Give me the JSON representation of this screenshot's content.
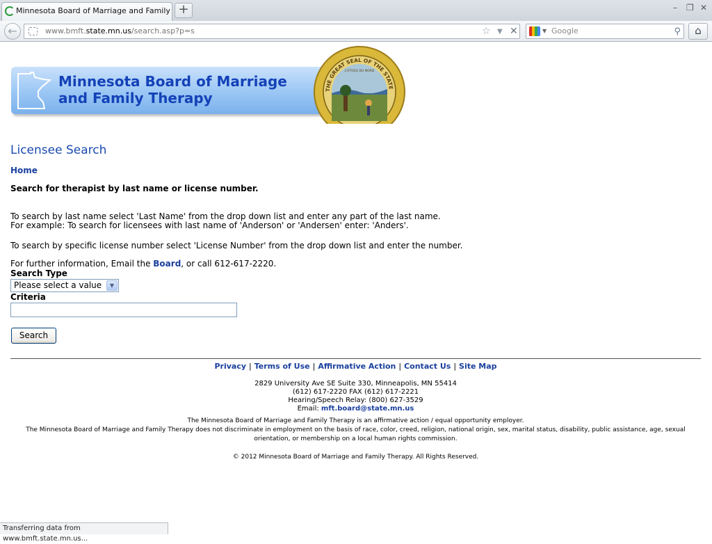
{
  "browser": {
    "tab_title": "Minnesota Board of Marriage and Family The...",
    "new_tab_label": "+",
    "url_prefix": "www.bmft.",
    "url_domain": "state.mn.us",
    "url_path": "/search.asp?p=s",
    "search_placeholder": "Google",
    "status_text": "Transferring data from www.bmft.state.mn.us..."
  },
  "banner": {
    "title_line1": "Minnesota Board of Marriage",
    "title_line2": "and Family Therapy",
    "seal_text": "THE GREAT SEAL OF THE STATE OF MINNESOTA",
    "seal_motto": "L'ETOILE DU NORD"
  },
  "page": {
    "title": "Licensee Search",
    "home_link": "Home",
    "heading": "Search for therapist by last name or license number.",
    "para1_line1": "To search by last name select 'Last Name' from the drop down list and enter any part of the last name.",
    "para1_line2": "For example: To search for licensees with last name of 'Anderson' or 'Andersen' enter: 'Anders'.",
    "para2": "To search by specific license number select 'License Number' from the drop down list and enter the number.",
    "info_before": "For further information, Email the ",
    "info_link": "Board",
    "info_after": ", or call 612-617-2220.",
    "search_type_label": "Search Type",
    "search_type_value": "Please select a value",
    "criteria_label": "Criteria",
    "criteria_value": "",
    "search_button": "Search"
  },
  "footer": {
    "nav": [
      "Privacy",
      "Terms of Use",
      "Affirmative Action",
      "Contact Us",
      "Site Map"
    ],
    "address": "2829 University Ave SE Suite 330, Minneapolis, MN 55414",
    "phone": "(612) 617-2220  FAX (612) 617-2221",
    "relay": "Hearing/Speech Relay: (800) 627-3529",
    "email_label": "Email: ",
    "email": "mft.board@state.mn.us",
    "eeo": "The Minnesota Board of Marriage and Family Therapy is an affirmative action / equal opportunity employer.",
    "nondiscrim_line1": "The Minnesota Board of Marriage and Family Therapy does not discriminate in employment on the basis of race, color, creed, religion, national origin, sex, marital status, disability, public assistance, age, sexual",
    "nondiscrim_line2": "orientation, or membership on a local human rights commission.",
    "copyright": "© 2012 Minnesota Board of Marriage and Family Therapy. All Rights Reserved."
  },
  "colors": {
    "link": "#1a3f9e",
    "title_blue": "#1a4ab0",
    "banner_text": "#1442b8"
  }
}
